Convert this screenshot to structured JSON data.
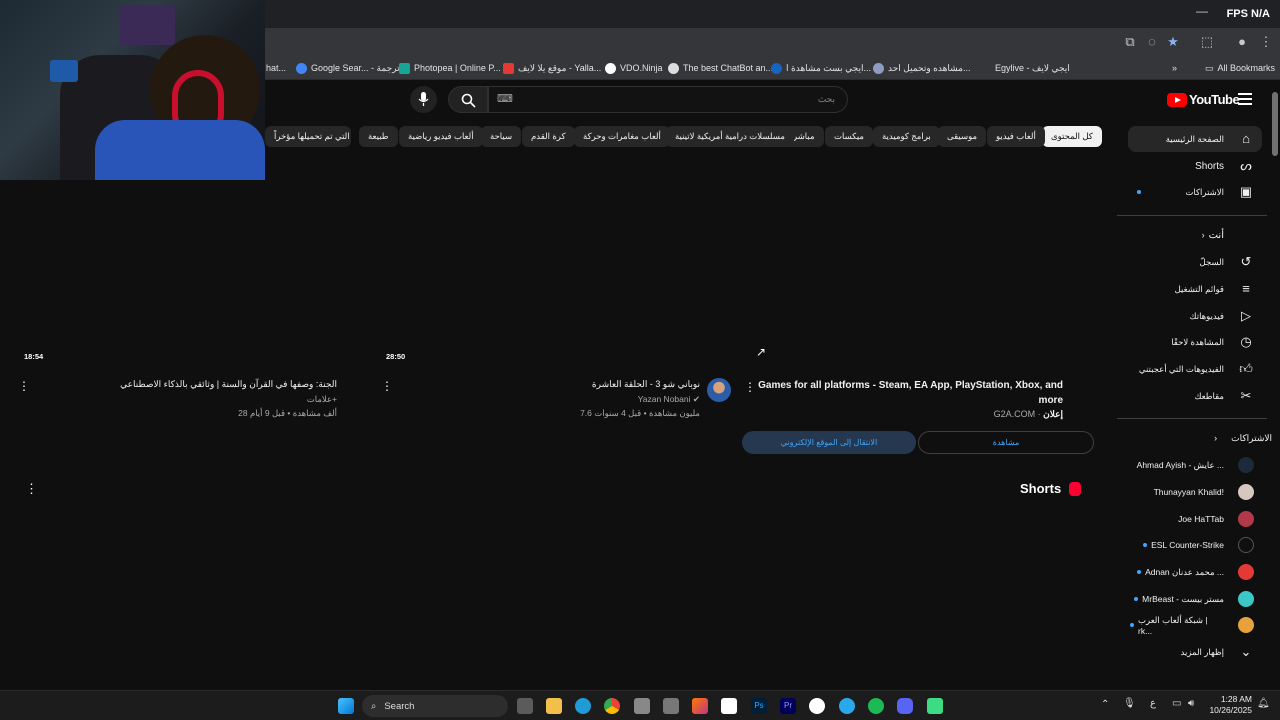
{
  "browser": {
    "fps_label": "FPS",
    "fps_value": "N/A",
    "bookmarks": [
      {
        "label": "hat..."
      },
      {
        "label": "Google Sear... - ترجمة",
        "color": "#4285f4"
      },
      {
        "label": "Photopea | Online P...",
        "color": "#18a497"
      },
      {
        "label": "موقع يلا لايف - Yalla...",
        "color": "#e53935"
      },
      {
        "label": "VDO.Ninja",
        "color": "#ffffff"
      },
      {
        "label": "The best ChatBot an...",
        "color": "#dddddd"
      },
      {
        "label": "ايجي بست مشاهدة ا...",
        "color": "#1565c0"
      },
      {
        "label": "مشاهده وتحميل احد...",
        "color": "#8e9cc2"
      },
      {
        "label": "Egylive - ايجي لايف"
      },
      {
        "label": "All Bookmarks"
      }
    ]
  },
  "youtube": {
    "logo_text": "YouTube",
    "search": {
      "placeholder": "بحث",
      "keyboard": "⌨"
    },
    "chips": [
      "كل المحتوى",
      "ألعاب فيديو",
      "موسيقى",
      "برامج كوميدية",
      "ميكسات",
      "مباشر",
      "مسلسلات درامية أمريكية لاتينية",
      "ألعاب مغامرات وحركة",
      "كرة القدم",
      "سياحة",
      "ألعاب فيديو رياضية",
      "طبيعة",
      "القنوات التي تم تحميلها مؤخراً"
    ],
    "ad": {
      "title_line1": "Games for all platforms - Steam, EA App, PlayStation, Xbox, and",
      "title_line2": "more",
      "sponsor": "إعلان",
      "domain": "G2A.COM",
      "btn_watch": "مشاهدة",
      "btn_visit": "الانتقال إلى الموقع الإلكتروني"
    },
    "videos": [
      {
        "title": "نوباني شو 3 - الحلقة العاشرة",
        "channel": "Yazan Nobani",
        "meta": "7.6 مليون مشاهدة • قبل 4 سنوات",
        "duration": "28:50"
      },
      {
        "title": "الجنة: وصفها في القرآن والسنة | وثائقي بالذكاء الاصطناعي",
        "channel": "علامات+",
        "meta": "28 ألف مشاهدة • قبل 9 أيام",
        "duration": "18:54"
      }
    ],
    "shorts_label": "Shorts",
    "sidebar": {
      "home": "الصفحة الرئيسية",
      "shorts": "Shorts",
      "subscriptions": "الاشتراكات",
      "you": "أنت",
      "history": "السجلّ",
      "playlists": "قوائم التشغيل",
      "your_videos": "فيديوهاتك",
      "watch_later": "المشاهدة لاحقًا",
      "liked": "الفيديوهات التي أعجبتني",
      "clips": "مقاطعك",
      "subs_header": "الاشتراكات",
      "channels": [
        {
          "name": "Ahmad Ayish - عايش ...",
          "color": "#1b2b3a"
        },
        {
          "name": "Thunayyan Khalid!",
          "color": "#d8c6c0"
        },
        {
          "name": "Joe HaTTab",
          "color": "#b23a48"
        },
        {
          "name": "ESL Counter-Strike",
          "color": "#101010"
        },
        {
          "name": "Adnan محمد عدنان ...",
          "color": "#e53935"
        },
        {
          "name": "MrBeast - مستر بيست",
          "color": "#3cc7c7"
        },
        {
          "name": "شبكة ألعاب العرب | rk...",
          "color": "#e8a23a"
        }
      ],
      "show_more": "إظهار المزيد"
    }
  },
  "taskbar": {
    "search": "Search",
    "time": "1:28 AM",
    "date": "10/26/2025",
    "lang": "ع"
  }
}
